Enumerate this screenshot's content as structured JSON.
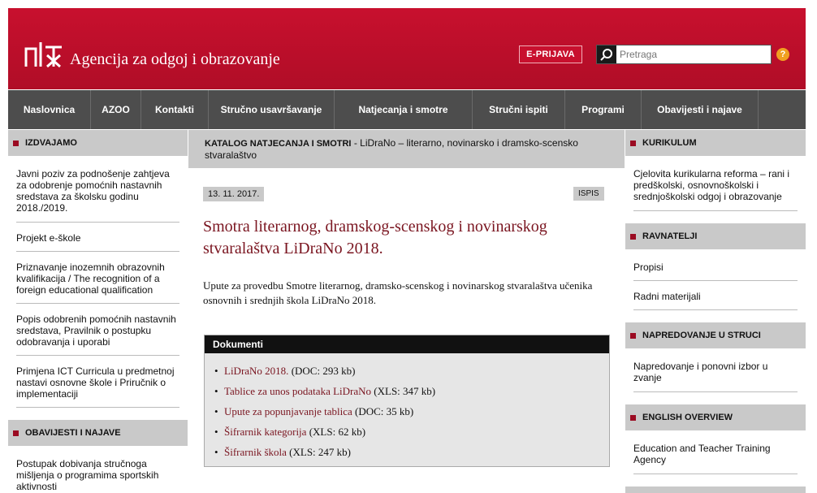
{
  "header": {
    "site_title": "Agencija za odgoj i obrazovanje",
    "eprijava_label": "E-PRIJAVA",
    "search_placeholder": "Pretraga",
    "help_label": "?"
  },
  "nav": {
    "items": [
      {
        "label": "Naslovnica"
      },
      {
        "label": "AZOO"
      },
      {
        "label": "Kontakti"
      },
      {
        "label": "Stručno usavršavanje"
      },
      {
        "label": "Natjecanja i smotre"
      },
      {
        "label": "Stručni ispiti"
      },
      {
        "label": "Programi"
      },
      {
        "label": "Obavijesti i najave"
      }
    ]
  },
  "left": {
    "izdvajamo_title": "IZDVAJAMO",
    "izdvajamo_items": [
      "Javni poziv za podnošenje zahtjeva za odobrenje pomoćnih nastavnih sredstava za školsku godinu 2018./2019.",
      "Projekt e-škole",
      "Priznavanje inozemnih obrazovnih kvalifikacija / The recognition of a foreign educational qualification",
      "Popis odobrenih pomoćnih nastavnih sredstava, Pravilnik o postupku odobravanja i uporabi",
      "Primjena ICT Curricula u predmetnoj nastavi osnovne škole i Priručnik o implementaciji"
    ],
    "obavijesti_title": "OBAVIJESTI I NAJAVE",
    "obavijesti_items": [
      "Postupak dobivanja stručnoga mišljenja o programima sportskih aktivnosti"
    ]
  },
  "right": {
    "kurikulum_title": "KURIKULUM",
    "kurikulum_items": [
      "Cjelovita kurikularna reforma – rani i predškolski, osnovnoškolski i srednjoškolski odgoj i obrazovanje"
    ],
    "ravnatelji_title": "RAVNATELJI",
    "ravnatelji_items": [
      "Propisi",
      "Radni materijali"
    ],
    "napredovanje_title": "NAPREDOVANJE U STRUCI",
    "napredovanje_items": [
      "Napredovanje i ponovni izbor u zvanje"
    ],
    "english_title": "ENGLISH OVERVIEW",
    "english_items": [
      "Education and Teacher Training Agency"
    ]
  },
  "main": {
    "breadcrumb_section": "KATALOG NATJECANJA I SMOTRI",
    "breadcrumb_rest": " - LiDraNo – literarno, novinarsko i dramsko-scensko stvaralaštvo",
    "date": "13. 11. 2017.",
    "ispis_label": "ISPIS",
    "title": "Smotra literarnog, dramskog-scenskog i novinarskog stvaralaštva LiDraNo 2018.",
    "lead": "Upute za provedbu Smotre literarnog, dramsko-scenskog i novinarskog stvaralaštva učenika osnovnih i srednjih škola LiDraNo 2018.",
    "docs_title": "Dokumenti",
    "docs": [
      {
        "name": "LiDraNo 2018.",
        "meta": " (DOC: 293 kb)"
      },
      {
        "name": "Tablice za unos podataka LiDraNo",
        "meta": " (XLS: 347 kb)"
      },
      {
        "name": "Upute za popunjavanje tablica",
        "meta": " (DOC: 35 kb)"
      },
      {
        "name": "Šifrarnik kategorija",
        "meta": " (XLS: 62 kb)"
      },
      {
        "name": "Šifrarnik škola",
        "meta": " (XLS: 247 kb)"
      }
    ]
  }
}
